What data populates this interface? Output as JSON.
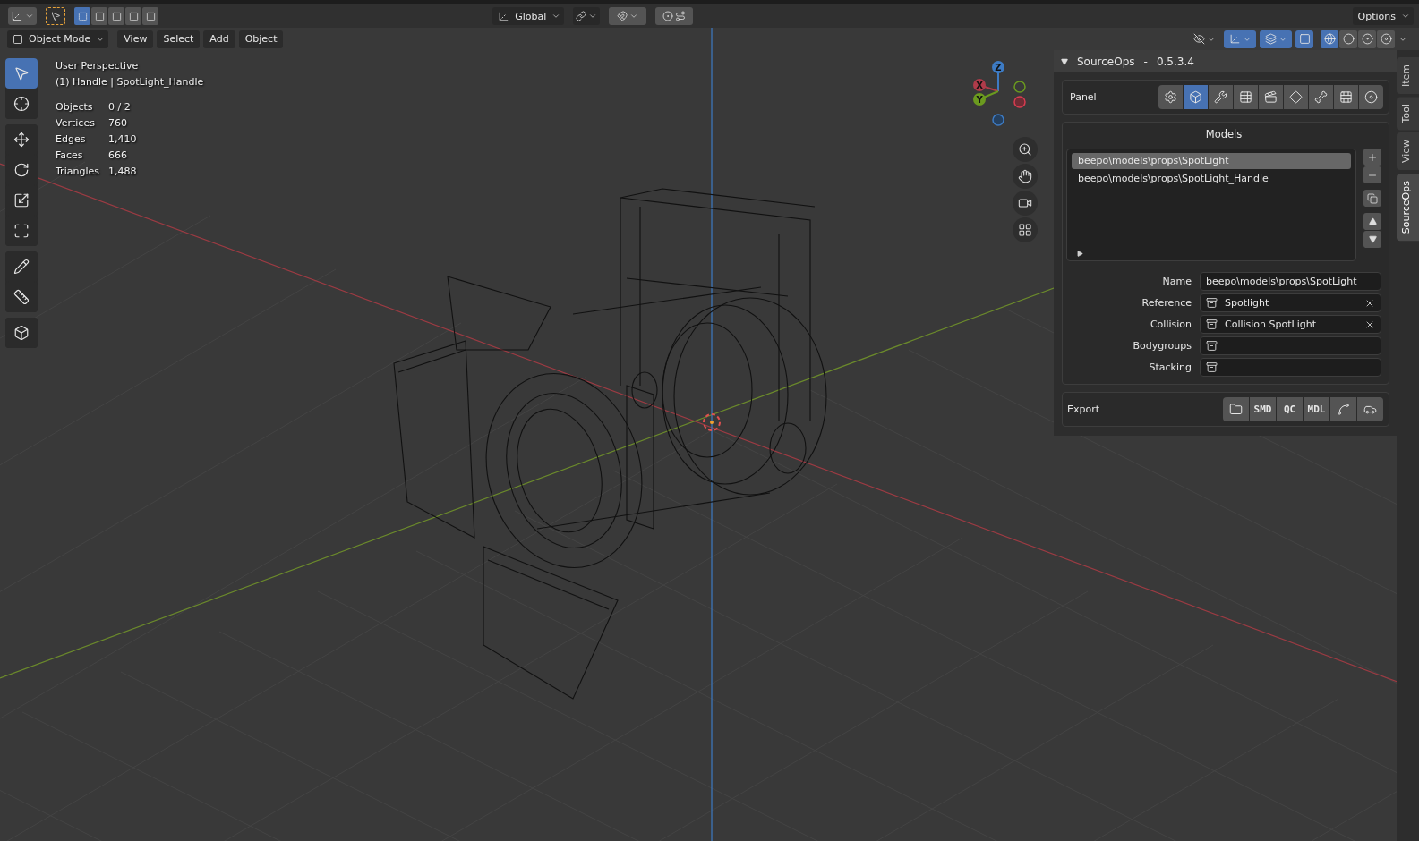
{
  "header": {
    "select_modes": [
      {
        "selected": true
      },
      {
        "selected": false
      },
      {
        "selected": false
      },
      {
        "selected": false
      },
      {
        "selected": false
      }
    ],
    "transform_orientation": "Global",
    "snap_on": false,
    "proportional_on": false,
    "options": "Options"
  },
  "view_header": {
    "mode": "Object Mode",
    "menus": [
      "View",
      "Select",
      "Add",
      "Object"
    ],
    "toggles": [
      {
        "kind": "visibility",
        "on": false
      },
      {
        "kind": "gizmo",
        "on": true
      },
      {
        "kind": "overlay",
        "on": true
      },
      {
        "kind": "xray",
        "on": true
      }
    ],
    "shading": [
      {
        "kind": "wireframe",
        "selected": true
      },
      {
        "kind": "solid",
        "selected": false
      },
      {
        "kind": "material",
        "selected": false
      },
      {
        "kind": "rendered",
        "selected": false
      }
    ]
  },
  "tool_groups": [
    [
      {
        "kind": "select",
        "selected": true
      },
      {
        "kind": "cursor",
        "selected": false
      }
    ],
    [
      {
        "kind": "move",
        "selected": false
      },
      {
        "kind": "rotate",
        "selected": false
      },
      {
        "kind": "scale",
        "selected": false
      },
      {
        "kind": "transform",
        "selected": false
      }
    ],
    [
      {
        "kind": "annotate",
        "selected": false
      },
      {
        "kind": "measure",
        "selected": false
      }
    ],
    [
      {
        "kind": "add_cube",
        "selected": false
      }
    ]
  ],
  "overlay": {
    "view_name": "User Perspective",
    "object_info": "(1) Handle | SpotLight_Handle",
    "stats": [
      {
        "label": "Objects",
        "value": "0 / 2"
      },
      {
        "label": "Vertices",
        "value": "760"
      },
      {
        "label": "Edges",
        "value": "1,410"
      },
      {
        "label": "Faces",
        "value": "666"
      },
      {
        "label": "Triangles",
        "value": "1,488"
      }
    ]
  },
  "gizmo": {
    "x": "X",
    "y": "Y",
    "z": "Z"
  },
  "sidebar": {
    "title": "SourceOps",
    "separator": "-",
    "version": "0.5.3.4",
    "panel_label": "Panel",
    "panel_tabs": [
      {
        "kind": "settings",
        "selected": false
      },
      {
        "kind": "object",
        "selected": true
      },
      {
        "kind": "wrench",
        "selected": false
      },
      {
        "kind": "texture",
        "selected": false
      },
      {
        "kind": "clapper",
        "selected": false
      },
      {
        "kind": "bounds",
        "selected": false
      },
      {
        "kind": "bone",
        "selected": false
      },
      {
        "kind": "brick",
        "selected": false
      },
      {
        "kind": "disc",
        "selected": false
      }
    ],
    "models_title": "Models",
    "models": [
      {
        "name": "beepo\\models\\props\\SpotLight",
        "selected": true
      },
      {
        "name": "beepo\\models\\props\\SpotLight_Handle",
        "selected": false
      }
    ],
    "fields": [
      {
        "label": "Name",
        "kind": "text",
        "value": "beepo\\models\\props\\SpotLight"
      },
      {
        "label": "Reference",
        "kind": "object",
        "value": "Spotlight"
      },
      {
        "label": "Collision",
        "kind": "object",
        "value": "Collision SpotLight"
      },
      {
        "label": "Bodygroups",
        "kind": "object"
      },
      {
        "label": "Stacking",
        "kind": "object"
      }
    ],
    "export_label": "Export",
    "export_buttons": [
      {
        "kind": "folder"
      },
      {
        "kind": "text",
        "label": "SMD"
      },
      {
        "kind": "text",
        "label": "QC"
      },
      {
        "kind": "text",
        "label": "MDL"
      },
      {
        "kind": "rig"
      },
      {
        "kind": "vehicle"
      }
    ],
    "tabs": [
      {
        "label": "Item",
        "selected": false
      },
      {
        "label": "Tool",
        "selected": false
      },
      {
        "label": "View",
        "selected": false
      },
      {
        "label": "SourceOps",
        "selected": true
      }
    ]
  }
}
